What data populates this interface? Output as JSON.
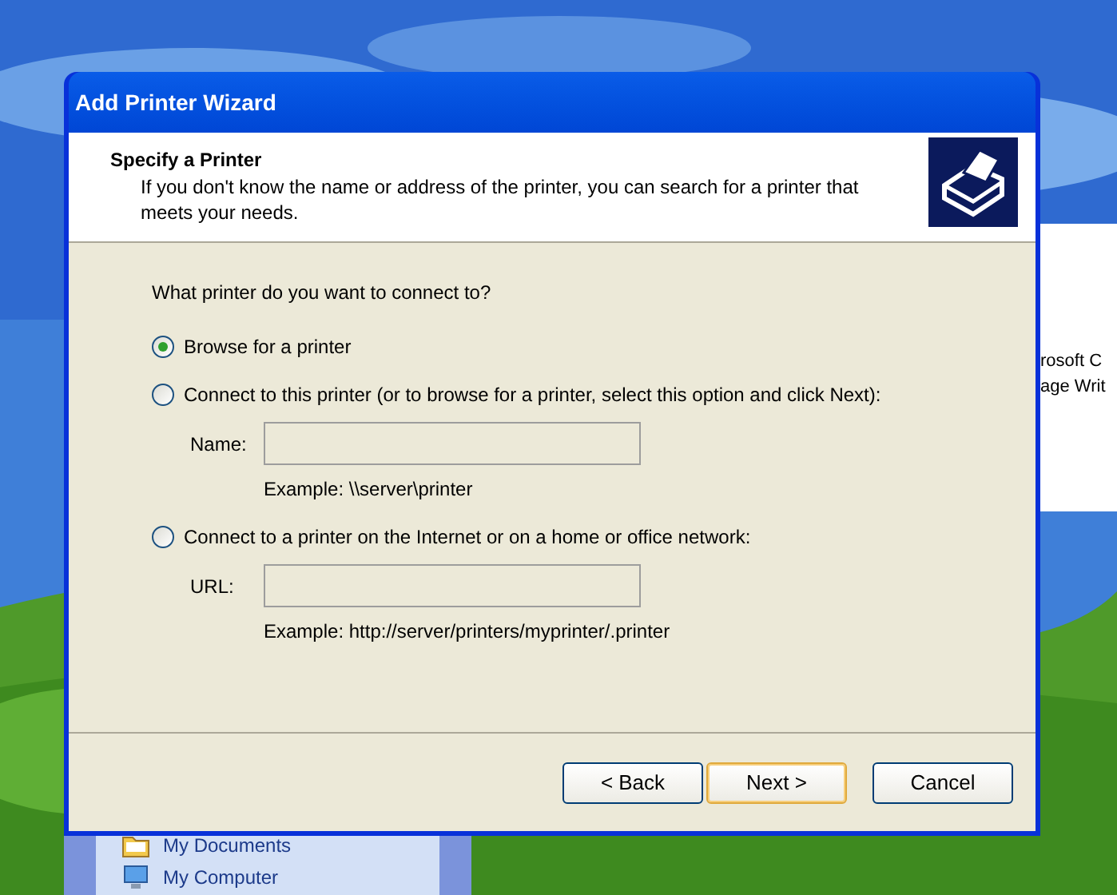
{
  "background_window": {
    "lines": [
      "rosoft C",
      "age Writ"
    ]
  },
  "start_menu": {
    "items": [
      {
        "label": "My Documents",
        "kind": "documents"
      },
      {
        "label": "My Computer",
        "kind": "computer"
      }
    ]
  },
  "dialog": {
    "title": "Add Printer Wizard",
    "header": {
      "title": "Specify a Printer",
      "description": "If you don't know the name or address of the printer, you can search for a printer that meets your needs."
    },
    "question": "What printer do you want to connect to?",
    "options": [
      {
        "label": "Browse for a printer",
        "selected": true
      },
      {
        "label": "Connect to this printer (or to browse for a printer, select this option and click Next):",
        "selected": false,
        "field": {
          "label": "Name:",
          "disabled": true,
          "example": "Example: \\\\server\\printer"
        }
      },
      {
        "label": "Connect to a printer on the Internet or on a home or office network:",
        "selected": false,
        "field": {
          "label": "URL:",
          "disabled": true,
          "example": "Example: http://server/printers/myprinter/.printer"
        }
      }
    ],
    "buttons": [
      {
        "label": "< Back",
        "default": false
      },
      {
        "label": "Next >",
        "default": true
      },
      {
        "label": "Cancel",
        "default": false
      }
    ]
  }
}
